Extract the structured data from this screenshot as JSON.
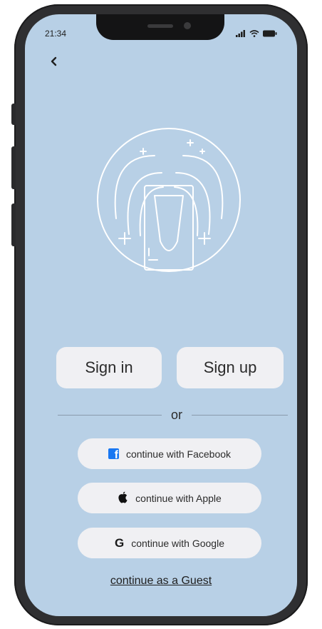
{
  "status_bar": {
    "time": "21:34",
    "icons": [
      "signal-icon",
      "wifi-icon",
      "battery-icon"
    ]
  },
  "nav": {
    "back_icon": "chevron-left-icon"
  },
  "logo": {
    "icon": "fountain-logo-icon"
  },
  "auth": {
    "sign_in_label": "Sign in",
    "sign_up_label": "Sign up",
    "divider_text": "or"
  },
  "social": {
    "facebook_label": "continue with Facebook",
    "apple_label": "continue with Apple",
    "google_label": "continue with Google"
  },
  "guest": {
    "label": "continue as a Guest"
  },
  "colors": {
    "screen_background": "#b8d0e6",
    "button_background": "#f0f0f3",
    "facebook_blue": "#1877f2",
    "phone_frame": "#2f2f31"
  }
}
